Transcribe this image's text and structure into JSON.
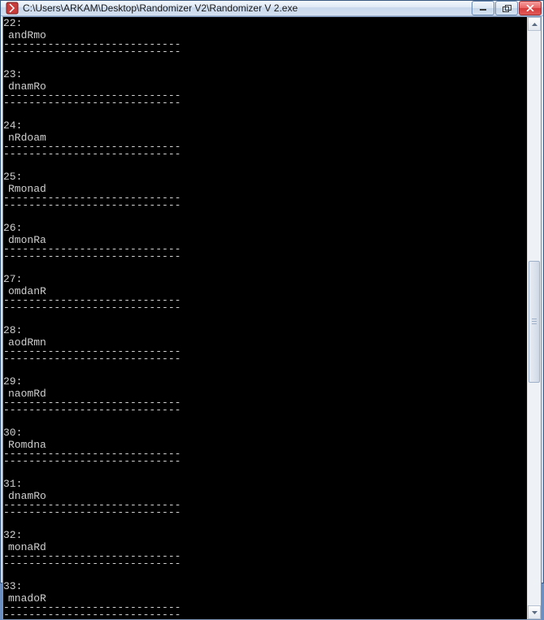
{
  "window": {
    "title": "C:\\Users\\ARKAM\\Desktop\\Randomizer V2\\Randomizer V 2.exe"
  },
  "separator1": "----------------------------",
  "separator2": "----------------------------",
  "entries": [
    {
      "n": "22:",
      "v": "andRmo"
    },
    {
      "n": "23:",
      "v": "dnamRo"
    },
    {
      "n": "24:",
      "v": "nRdoam"
    },
    {
      "n": "25:",
      "v": "Rmonad"
    },
    {
      "n": "26:",
      "v": "dmonRa"
    },
    {
      "n": "27:",
      "v": "omdanR"
    },
    {
      "n": "28:",
      "v": "aodRmn"
    },
    {
      "n": "29:",
      "v": "naomRd"
    },
    {
      "n": "30:",
      "v": "Romdna"
    },
    {
      "n": "31:",
      "v": "dnamRo"
    },
    {
      "n": "32:",
      "v": "monaRd"
    },
    {
      "n": "33:",
      "v": "mnadoR"
    }
  ]
}
